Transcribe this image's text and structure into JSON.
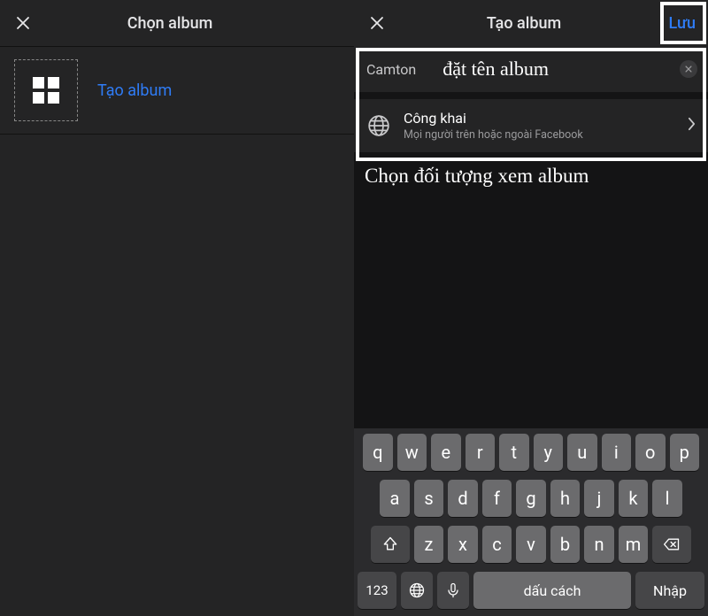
{
  "left": {
    "title": "Chọn album",
    "create_label": "Tạo album"
  },
  "right": {
    "title": "Tạo album",
    "save": "Lưu",
    "prefix": "Camton",
    "placeholder": "đặt tên album",
    "privacy": {
      "title": "Công khai",
      "subtitle": "Mọi người trên hoặc ngoài Facebook"
    },
    "caption": "Chọn đối tượng xem album"
  },
  "keyboard": {
    "row1": [
      "q",
      "w",
      "e",
      "r",
      "t",
      "y",
      "u",
      "i",
      "o",
      "p"
    ],
    "row2": [
      "a",
      "s",
      "d",
      "f",
      "g",
      "h",
      "j",
      "k",
      "l"
    ],
    "row3": [
      "z",
      "x",
      "c",
      "v",
      "b",
      "n",
      "m"
    ],
    "numbers": "123",
    "space": "dấu cách",
    "enter": "Nhập"
  }
}
